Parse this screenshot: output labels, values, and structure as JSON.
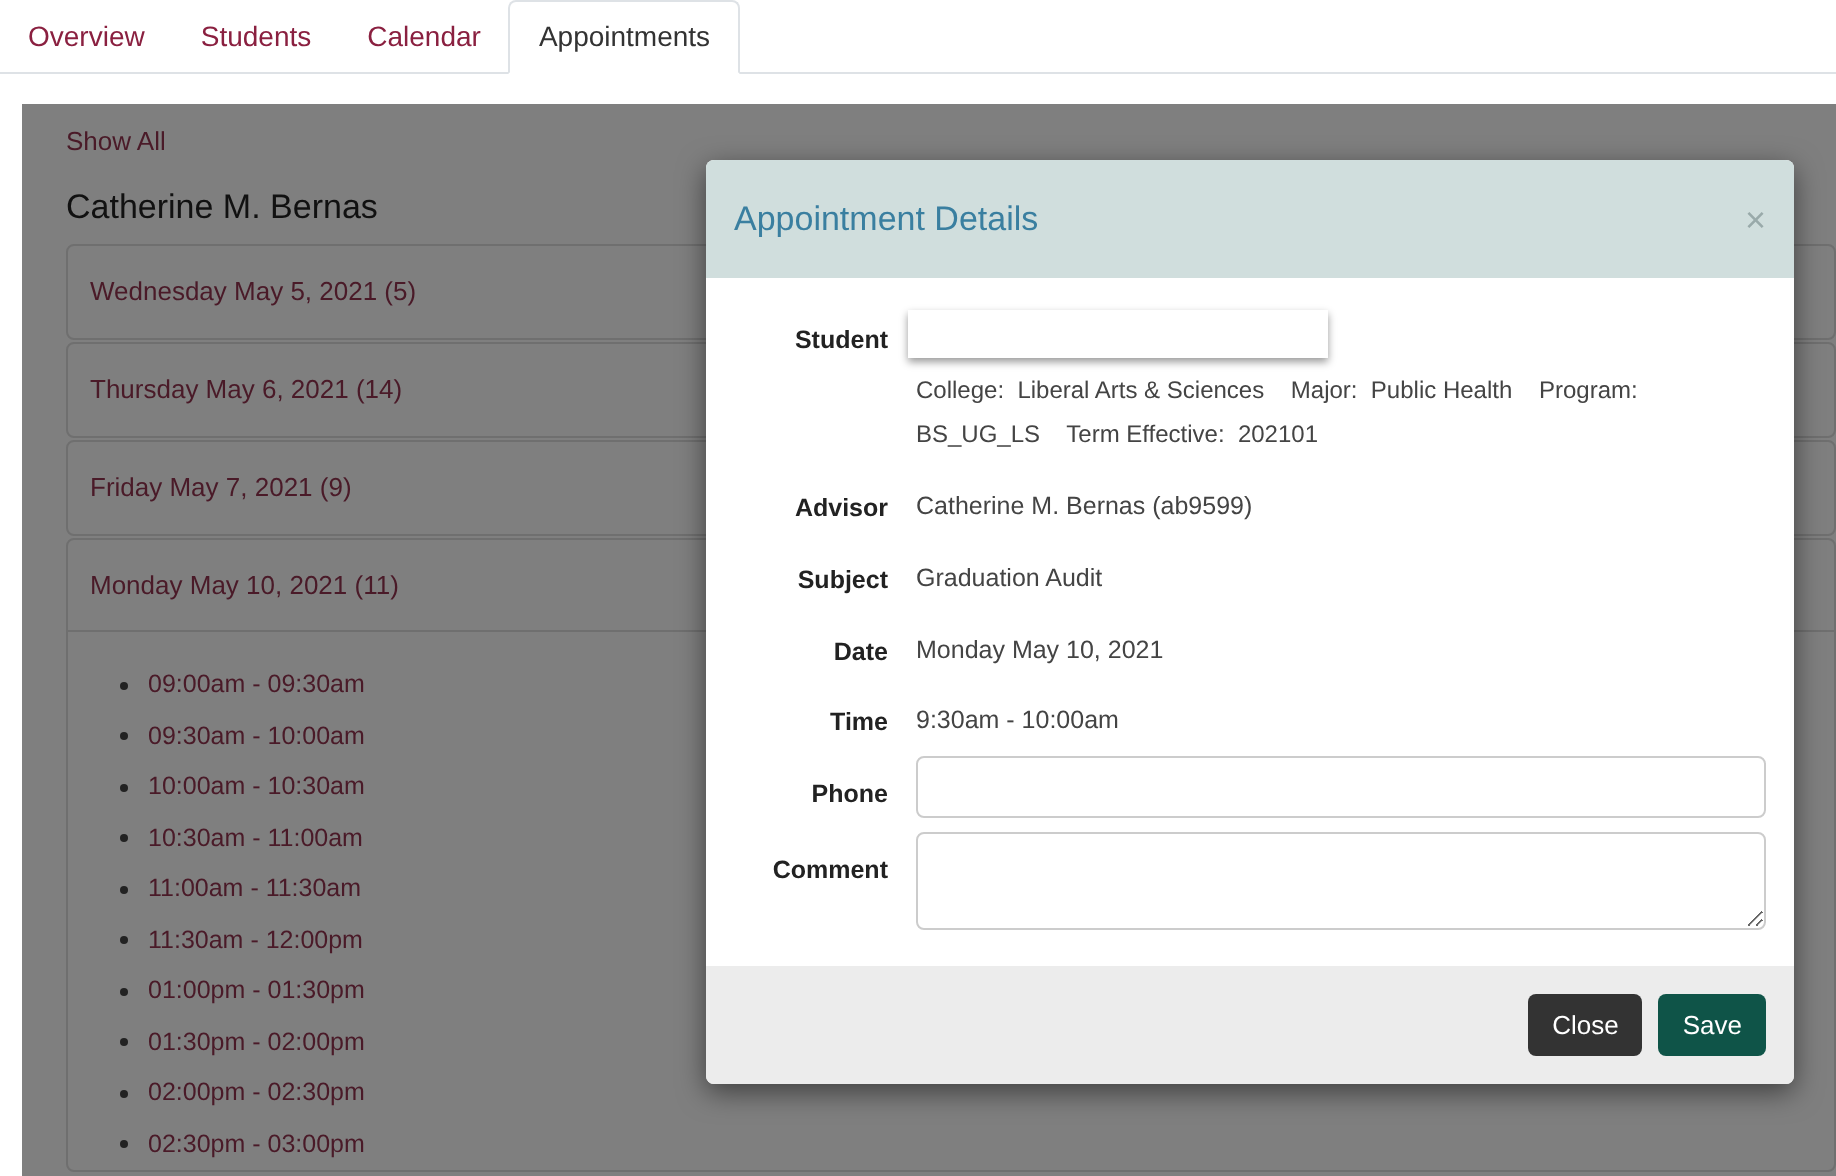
{
  "tabs": [
    {
      "label": "Overview",
      "selected": false
    },
    {
      "label": "Students",
      "selected": false
    },
    {
      "label": "Calendar",
      "selected": false
    },
    {
      "label": "Appointments",
      "selected": true
    }
  ],
  "show_all": "Show All",
  "advisor_heading": "Catherine M. Bernas",
  "days": [
    {
      "label": "Wednesday May 5, 2021 (5)",
      "expanded": false
    },
    {
      "label": "Thursday May 6, 2021 (14)",
      "expanded": false
    },
    {
      "label": "Friday May 7, 2021 (9)",
      "expanded": false
    },
    {
      "label": "Monday May 10, 2021 (11)",
      "expanded": true,
      "slots": [
        "09:00am - 09:30am",
        "09:30am - 10:00am",
        "10:00am - 10:30am",
        "10:30am - 11:00am",
        "11:00am - 11:30am",
        "11:30am - 12:00pm",
        "01:00pm - 01:30pm",
        "01:30pm - 02:00pm",
        "02:00pm - 02:30pm",
        "02:30pm - 03:00pm"
      ]
    }
  ],
  "modal": {
    "title": "Appointment Details",
    "close_icon": "×",
    "rows": [
      {
        "kind": "student",
        "label": "Student",
        "info": "College:  Liberal Arts & Sciences    Major:  Public Health    Program:  BS_UG_LS    Term Effective:  202101"
      },
      {
        "kind": "text",
        "label": "Advisor",
        "value": "Catherine M. Bernas (ab9599)"
      },
      {
        "kind": "text",
        "label": "Subject",
        "value": "Graduation Audit"
      },
      {
        "kind": "text",
        "label": "Date",
        "value": "Monday May 10, 2021"
      },
      {
        "kind": "text",
        "label": "Time",
        "value": "9:30am - 10:00am"
      },
      {
        "kind": "input",
        "label": "Phone"
      },
      {
        "kind": "textarea",
        "label": "Comment"
      }
    ],
    "buttons": [
      {
        "label": "Close",
        "kind": "secondary"
      },
      {
        "label": "Save",
        "kind": "primary"
      }
    ]
  }
}
